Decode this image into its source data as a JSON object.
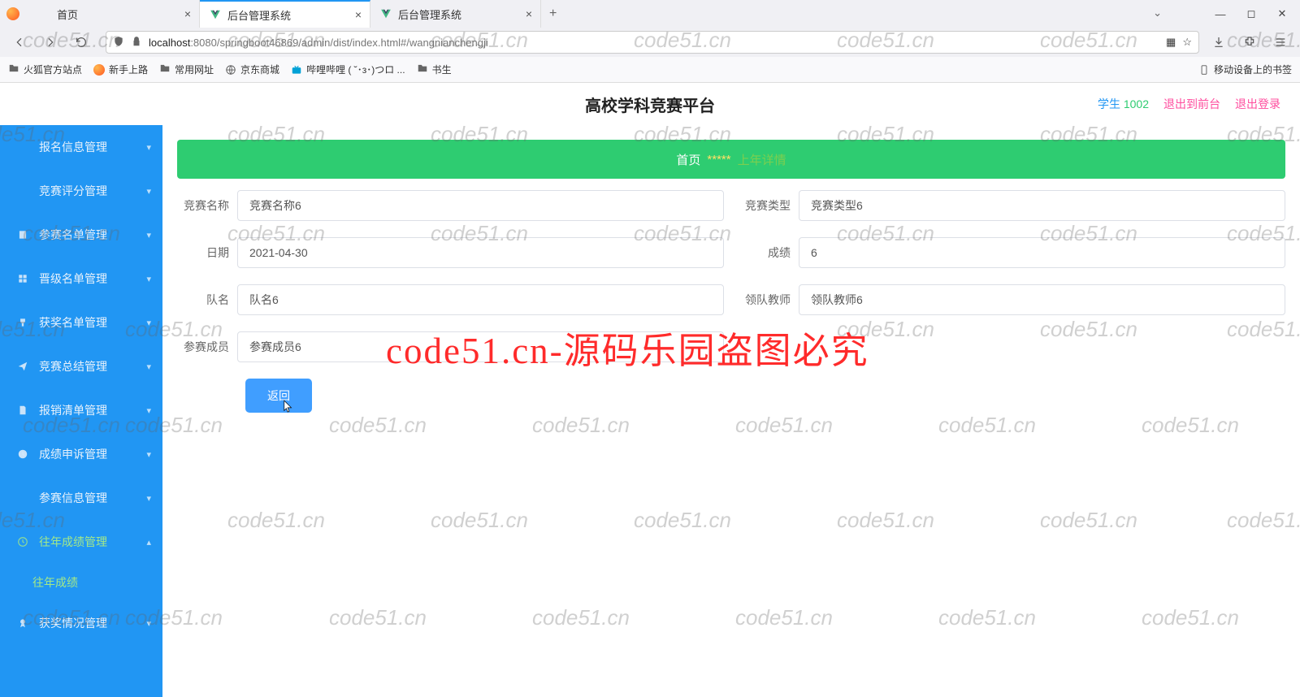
{
  "browser": {
    "tabs": [
      {
        "title": "首页",
        "active": false,
        "favicon": "firefox"
      },
      {
        "title": "后台管理系统",
        "active": true,
        "favicon": "vue"
      },
      {
        "title": "后台管理系统",
        "active": false,
        "favicon": "vue"
      }
    ],
    "url_host": "localhost",
    "url_path": ":8080/springboot46869/admin/dist/index.html#/wangnianchengji",
    "bookmarks": [
      "火狐官方站点",
      "新手上路",
      "常用网址",
      "京东商城",
      "哔哩哔哩 ( ˘･з･)つロ ...",
      "书生"
    ],
    "mobile_bm": "移动设备上的书签"
  },
  "header": {
    "title": "高校学科竞赛平台",
    "user_label": "学生",
    "user_id": "1002",
    "logout_front": "退出到前台",
    "logout": "退出登录"
  },
  "sidebar": {
    "items": [
      "报名信息管理",
      "竞赛评分管理",
      "参赛名单管理",
      "晋级名单管理",
      "获奖名单管理",
      "竞赛总结管理",
      "报销清单管理",
      "成绩申诉管理",
      "参赛信息管理",
      "往年成绩管理",
      "获奖情况管理"
    ],
    "active_index": 9,
    "sub_item": "往年成绩"
  },
  "breadcrumb": {
    "home": "首页",
    "sep": "*****",
    "current": "上年详情"
  },
  "form": {
    "fields": {
      "competition_name": {
        "label": "竞赛名称",
        "value": "竞赛名称6"
      },
      "competition_type": {
        "label": "竞赛类型",
        "value": "竞赛类型6"
      },
      "date": {
        "label": "日期",
        "value": "2021-04-30"
      },
      "score": {
        "label": "成绩",
        "value": "6"
      },
      "team_name": {
        "label": "队名",
        "value": "队名6"
      },
      "lead_teacher": {
        "label": "领队教师",
        "value": "领队教师6"
      },
      "members": {
        "label": "参赛成员",
        "value": "参赛成员6"
      }
    },
    "back_btn": "返回"
  },
  "watermark": {
    "small": "code51.cn",
    "big": "code51.cn-源码乐园盗图必究"
  }
}
